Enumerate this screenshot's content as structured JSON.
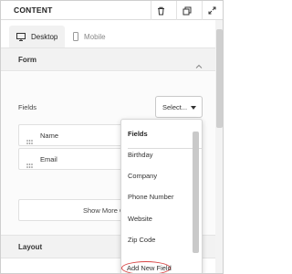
{
  "header": {
    "title": "CONTENT"
  },
  "icons": {
    "delete": "trash-icon",
    "duplicate": "copy-icon",
    "expand": "expand-icon"
  },
  "tabs": [
    {
      "label": "Desktop",
      "icon": "desktop-icon",
      "active": true
    },
    {
      "label": "Mobile",
      "icon": "mobile-icon",
      "active": false
    }
  ],
  "form_section": {
    "title": "Form"
  },
  "fields": {
    "label": "Fields",
    "select_value": "Select...",
    "rows": [
      "Name",
      "Email"
    ],
    "show_more_label": "Show More O"
  },
  "dropdown": {
    "header": "Fields",
    "options": [
      "Birthday",
      "Company",
      "Phone Number",
      "Website",
      "Zip Code"
    ],
    "add_new": "Add New Field"
  },
  "layout_section": {
    "title": "Layout"
  },
  "colors": {
    "highlight_circle": "#d94545",
    "section_bg": "#f2f2f2"
  }
}
